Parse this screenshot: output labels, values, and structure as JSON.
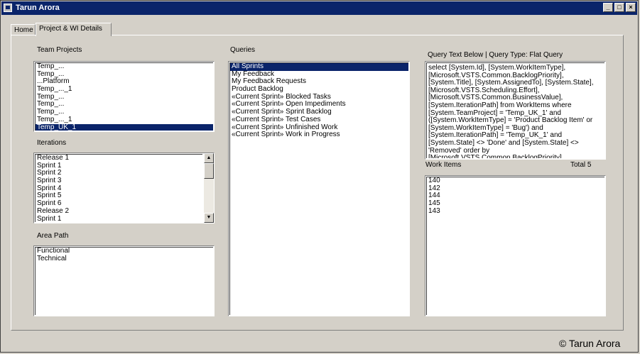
{
  "window": {
    "title": "Tarun Arora",
    "controls": {
      "minimize": "_",
      "maximize": "□",
      "close": "×"
    }
  },
  "tabs": [
    {
      "label": "Home",
      "active": false
    },
    {
      "label": "Project & WI Details",
      "active": true
    }
  ],
  "team_projects": {
    "label": "Team Projects",
    "items": [
      "Temp_...",
      "Temp_...",
      "...Platform",
      "Temp_..._1",
      "Temp_...",
      "Temp_...",
      "Temp_...",
      "Temp_..._1",
      "Temp_UK_1"
    ],
    "selected_index": 8
  },
  "iterations": {
    "label": "Iterations",
    "items": [
      "Release 1",
      "Sprint 1",
      "Sprint 2",
      "Sprint 3",
      "Sprint 4",
      "Sprint 5",
      "Sprint 6",
      "Release 2",
      "Sprint 1"
    ],
    "scroll_up_icon": "triangle-up",
    "scroll_down_icon": "triangle-down"
  },
  "area_path": {
    "label": "Area Path",
    "items": [
      "Functional",
      "Technical"
    ]
  },
  "queries": {
    "label": "Queries",
    "items": [
      "All Sprints",
      "My Feedback",
      "My Feedback Requests",
      "Product Backlog",
      "«Current Sprint» Blocked Tasks",
      "«Current Sprint» Open Impediments",
      "«Current Sprint» Sprint Backlog",
      "«Current Sprint» Test Cases",
      "«Current Sprint» Unfinished Work",
      "«Current Sprint» Work in Progress"
    ],
    "selected_index": 0
  },
  "query_text": {
    "label": "Query Text Below | Query Type: Flat Query",
    "value": "select [System.Id], [System.WorkItemType], [Microsoft.VSTS.Common.BacklogPriority], [System.Title], [System.AssignedTo], [System.State], [Microsoft.VSTS.Scheduling.Effort], [Microsoft.VSTS.Common.BusinessValue], [System.IterationPath] from WorkItems where [System.TeamProject] = 'Temp_UK_1' and ([System.WorkItemType] = 'Product Backlog Item' or [System.WorkItemType] = 'Bug') and [System.IterationPath] = 'Temp_UK_1' and [System.State] <> 'Done' and [System.State] <> 'Removed' order by [Microsoft.VSTS.Common.BacklogPriority],"
  },
  "work_items": {
    "label": "Work Items",
    "total_label": "Total 5",
    "items": [
      "140",
      "142",
      "144",
      "145",
      "143"
    ]
  },
  "watermark": "© Tarun Arora",
  "colors": {
    "selection": "#0a246a",
    "titlebar": "#0a246a",
    "face": "#d4d0c8"
  }
}
